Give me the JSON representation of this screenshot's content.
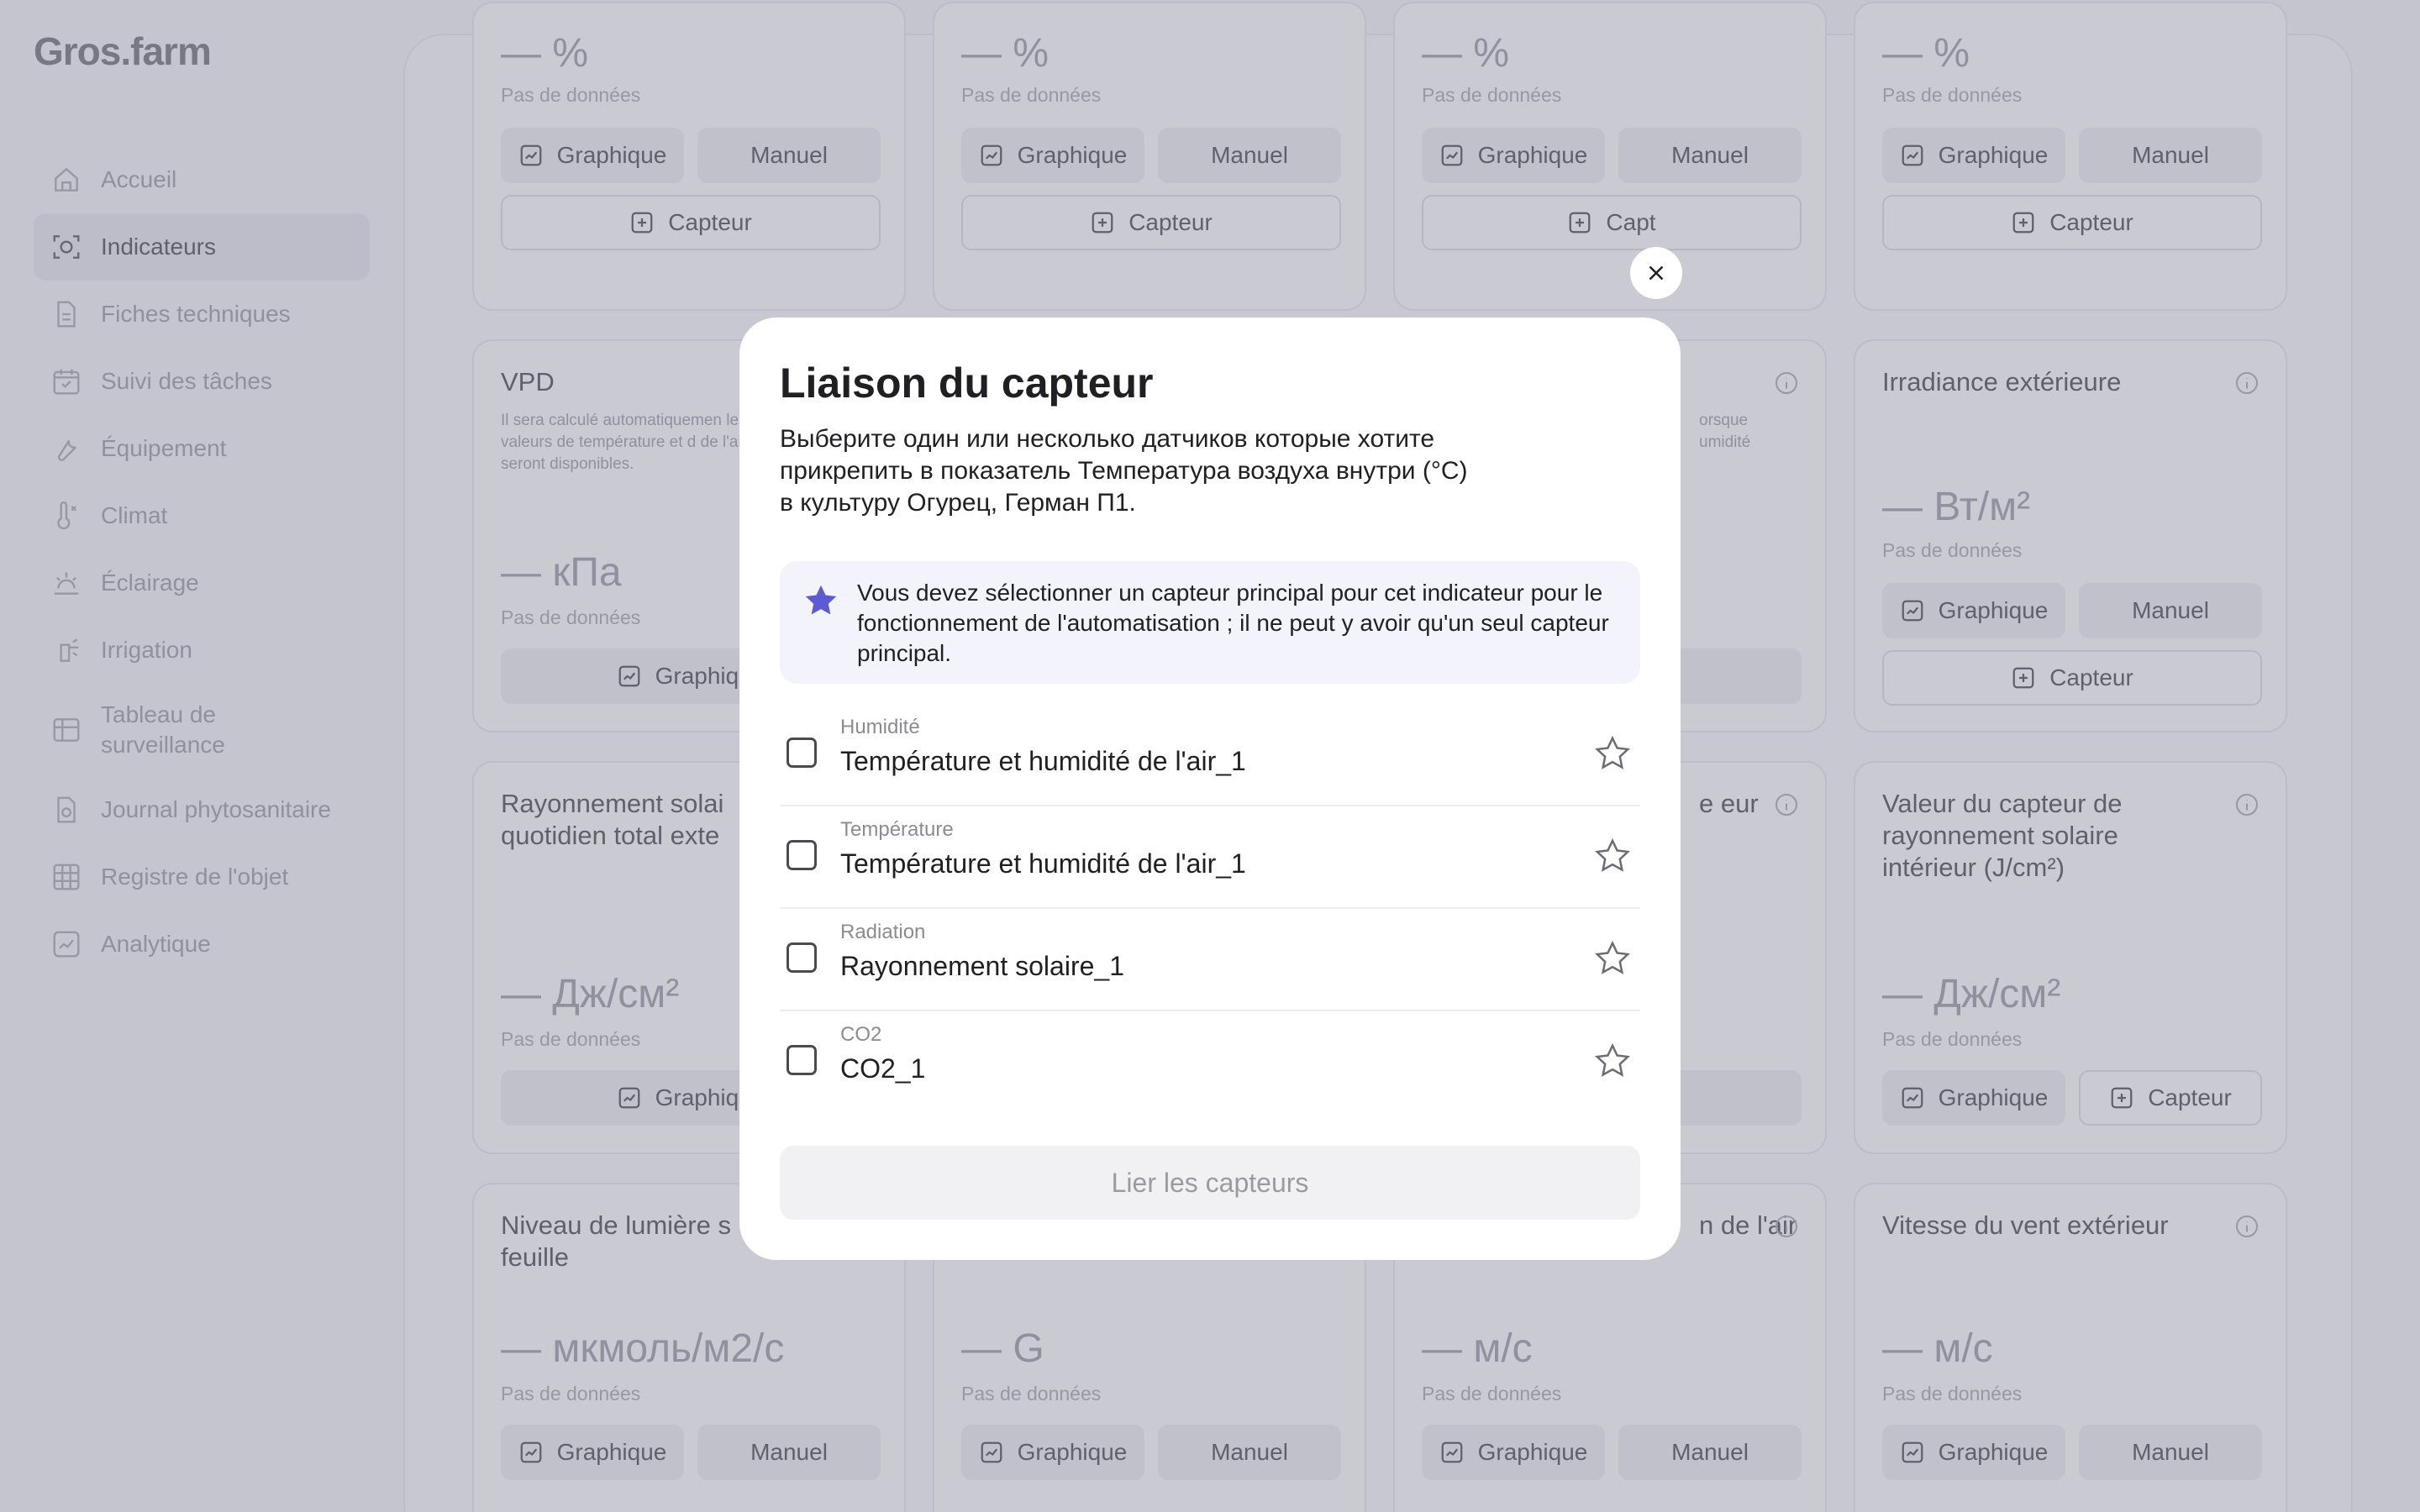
{
  "app": {
    "logo": "Gros.farm"
  },
  "sidebar": {
    "items": [
      {
        "label": "Accueil",
        "icon": "home-icon",
        "active": false
      },
      {
        "label": "Indicateurs",
        "icon": "indicators-icon",
        "active": true
      },
      {
        "label": "Fiches techniques",
        "icon": "document-icon",
        "active": false
      },
      {
        "label": "Suivi des tâches",
        "icon": "calendar-icon",
        "active": false
      },
      {
        "label": "Équipement",
        "icon": "wrench-icon",
        "active": false
      },
      {
        "label": "Climat",
        "icon": "thermometer-icon",
        "active": false
      },
      {
        "label": "Éclairage",
        "icon": "sunrise-icon",
        "active": false
      },
      {
        "label": "Irrigation",
        "icon": "sprinkler-icon",
        "active": false
      },
      {
        "label": "Tableau de surveillance",
        "icon": "table-icon",
        "active": false
      },
      {
        "label": "Journal phytosanitaire",
        "icon": "journal-icon",
        "active": false
      },
      {
        "label": "Registre de l'objet",
        "icon": "grid-icon",
        "active": false
      },
      {
        "label": "Analytique",
        "icon": "chart-icon",
        "active": false
      }
    ]
  },
  "common": {
    "no_data": "Pas de données",
    "graph": "Graphique",
    "manual": "Manuel",
    "sensor": "Capteur",
    "graph_partial": "Graphiq",
    "sensor_partial": "Capt"
  },
  "cards": {
    "r1c1": {
      "value": "— %"
    },
    "r1c2": {
      "value": "— %"
    },
    "r1c3": {
      "value": "— %"
    },
    "r1c4": {
      "value": "— %"
    },
    "r2c1": {
      "title": "VPD",
      "desc": "Il sera calculé automatiquemen les valeurs de température et d de l'air seront disponibles.",
      "value": "— кПа"
    },
    "r2c3": {
      "desc": "orsque umidité"
    },
    "r2c4": {
      "title": "Irradiance extérieure",
      "value": "— Вт/м²"
    },
    "r3c1": {
      "title": "Rayonnement solai quotidien total exte",
      "value": "— Дж/см²"
    },
    "r3c3": {
      "title": "e eur"
    },
    "r3c4": {
      "title": "Valeur du capteur de rayonnement solaire intérieur (J/cm²)",
      "value": "— Дж/см²"
    },
    "r4c1": {
      "title": "Niveau de lumière s feuille",
      "value": "— мкмоль/м2/с"
    },
    "r4c2": {
      "value": "— G"
    },
    "r4c3": {
      "title": "n de l'air",
      "value": "— м/с"
    },
    "r4c4": {
      "title": "Vitesse du vent extérieur",
      "value": "— м/с"
    }
  },
  "modal": {
    "title": "Liaison du capteur",
    "subtitle_line1": "Выберите один или несколько датчиков которые хотите",
    "subtitle_line2": "прикрепить в показатель  Температура воздуха внутри (°C)",
    "subtitle_line3": "в культуру Огурец, Герман П1.",
    "notice": "Vous devez sélectionner un capteur principal pour cet indicateur pour le fonctionnement de l'automatisation ; il ne peut y avoir qu'un seul capteur principal.",
    "sensors": [
      {
        "type": "Humidité",
        "name": "Température et humidité de l'air_1",
        "checked": false
      },
      {
        "type": "Température",
        "name": "Température et humidité de l'air_1",
        "checked": false
      },
      {
        "type": "Radiation",
        "name": "Rayonnement solaire_1",
        "checked": false
      },
      {
        "type": "CO2",
        "name": "CO2_1",
        "checked": false
      }
    ],
    "submit_label": "Lier les capteurs",
    "accent_color": "#5b5bd6"
  }
}
